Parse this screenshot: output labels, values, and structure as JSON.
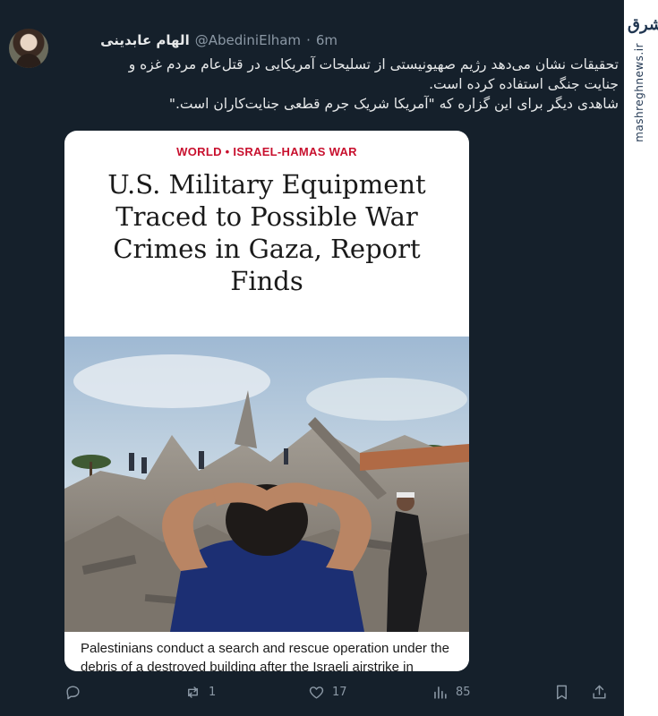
{
  "watermark": {
    "logo_text": "مشرق",
    "site": "mashreghnews.ir"
  },
  "tweet": {
    "author_name": "الهام عابدینی",
    "handle": "@AbediniElham",
    "separator": "·",
    "time": "6m",
    "text_lines": [
      "تحقیقات نشان می‌دهد رژیم صهیونیستی از تسلیحات آمریکایی در قتل‌عام مردم غزه و",
      "جنایت جنگی استفاده کرده است.",
      "شاهدی دیگر برای این گزاره که \"آمریکا شریک جرم قطعی جنایت‌کاران است.\""
    ]
  },
  "card": {
    "kicker": "WORLD • ISRAEL-HAMAS WAR",
    "headline": "U.S. Military Equipment Traced to Possible War Crimes in Gaza, Report Finds",
    "caption": "Palestinians conduct a search and rescue operation under the debris of a destroyed building after the Israeli airstrike in"
  },
  "actions": {
    "replies": "",
    "retweets": "1",
    "likes": "17",
    "views": "85"
  },
  "icons": [
    "reply-icon",
    "retweet-icon",
    "like-icon",
    "views-icon",
    "bookmark-icon",
    "share-icon"
  ]
}
